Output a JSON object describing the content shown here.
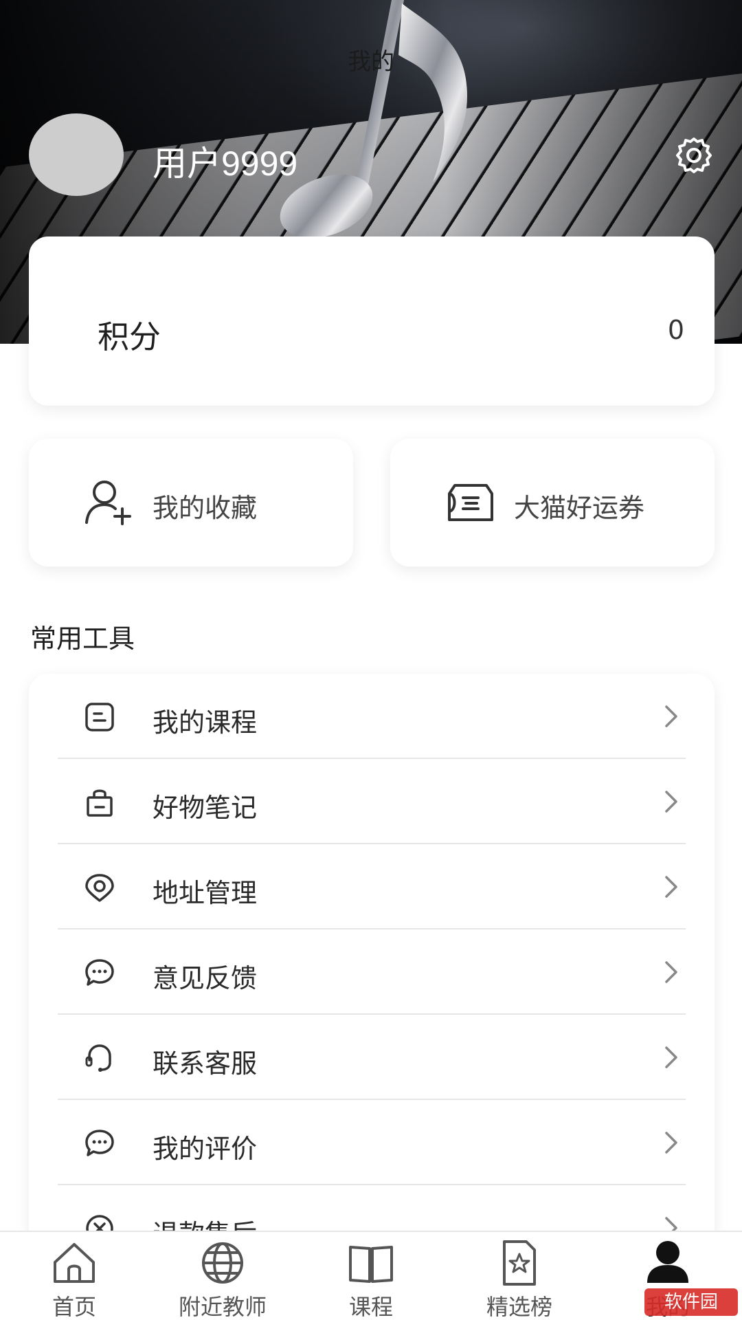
{
  "header": {
    "title": "我的",
    "username": "用户9999"
  },
  "points": {
    "label": "积分",
    "value": "0"
  },
  "quick_actions": [
    {
      "label": "我的收藏",
      "icon": "add-user-icon"
    },
    {
      "label": "大猫好运券",
      "icon": "ticket-icon"
    }
  ],
  "tools": {
    "section_title": "常用工具",
    "items": [
      {
        "label": "我的课程",
        "icon": "course-icon"
      },
      {
        "label": "好物笔记",
        "icon": "shopping-bag-icon"
      },
      {
        "label": "地址管理",
        "icon": "location-pin-icon"
      },
      {
        "label": "意见反馈",
        "icon": "chat-bubble-icon"
      },
      {
        "label": "联系客服",
        "icon": "headset-icon"
      },
      {
        "label": "我的评价",
        "icon": "comment-icon"
      },
      {
        "label": "退款售后",
        "icon": "refund-icon"
      }
    ]
  },
  "tabbar": {
    "items": [
      {
        "label": "首页",
        "icon": "home-icon"
      },
      {
        "label": "附近教师",
        "icon": "globe-icon"
      },
      {
        "label": "课程",
        "icon": "book-icon"
      },
      {
        "label": "精选榜",
        "icon": "star-document-icon"
      },
      {
        "label": "我的",
        "icon": "person-icon",
        "active": true
      }
    ]
  },
  "watermark": "软件园",
  "colors": {
    "accent": "#111111",
    "divider": "#e6e6e6",
    "watermark": "#d9302c"
  }
}
